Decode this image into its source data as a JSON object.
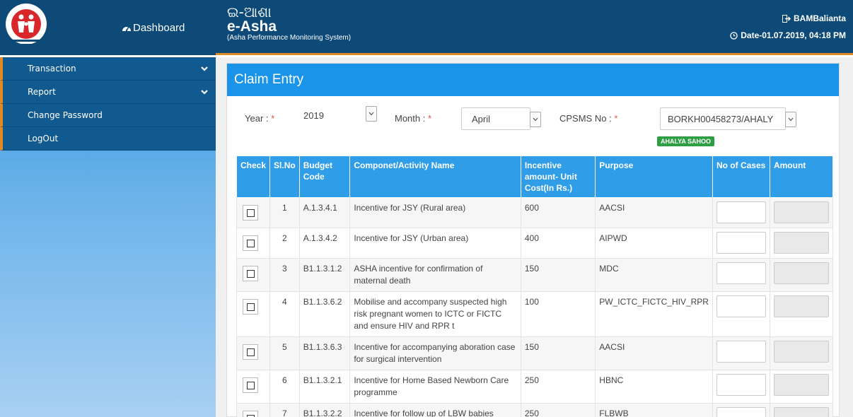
{
  "header": {
    "dashboard_label": "Dashboard",
    "brand_odia": "ଇ-ଆଶା",
    "brand_name": "e-Asha",
    "brand_subtitle": "(Asha Performance Monitoring System)",
    "user": "BAMBalianta",
    "date": "Date-01.07.2019, 04:18 PM",
    "logo_text": "NATIONAL RURAL HEALTH MISSION"
  },
  "sidebar": {
    "items": [
      {
        "label": "Transaction",
        "has_submenu": true
      },
      {
        "label": "Report",
        "has_submenu": true
      },
      {
        "label": "Change Password",
        "has_submenu": false
      },
      {
        "label": "LogOut",
        "has_submenu": false
      }
    ]
  },
  "panel": {
    "title": "Claim Entry"
  },
  "filters": {
    "year_label": "Year :",
    "year_value": "2019",
    "month_label": "Month :",
    "month_value": "April",
    "cpsms_label": "CPSMS No :",
    "cpsms_value": "BORKH00458273/AHALY",
    "required_mark": "*",
    "asha_name": "AHALYA SAHOO"
  },
  "table": {
    "headers": [
      "Check",
      "Sl.No",
      "Budget Code",
      "Componet/Activity Name",
      "Incentive amount- Unit Cost(In Rs.)",
      "Purpose",
      "No of Cases",
      "Amount"
    ],
    "rows": [
      {
        "sl": "1",
        "code": "A.1.3.4.1",
        "activity": "Incentive for JSY (Rural area)",
        "cost": "600",
        "purpose": "AACSI"
      },
      {
        "sl": "2",
        "code": "A.1.3.4.2",
        "activity": "Incentive for JSY (Urban area)",
        "cost": "400",
        "purpose": "AIPWD"
      },
      {
        "sl": "3",
        "code": "B1.1.3.1.2",
        "activity": "ASHA incentive for confirmation of maternal death",
        "cost": "150",
        "purpose": "MDC"
      },
      {
        "sl": "4",
        "code": "B1.1.3.6.2",
        "activity": "Mobilise and accompany suspected high risk pregnant women to ICTC or FICTC and ensure HIV and RPR t",
        "cost": "100",
        "purpose": "PW_ICTC_FICTC_HIV_RPR"
      },
      {
        "sl": "5",
        "code": "B1.1.3.6.3",
        "activity": "Incentive for accompanying aboration case for surgical intervention",
        "cost": "150",
        "purpose": "AACSI"
      },
      {
        "sl": "6",
        "code": "B1.1.3.2.1",
        "activity": "Incentive for Home Based Newborn Care programme",
        "cost": "250",
        "purpose": "HBNC"
      },
      {
        "sl": "7",
        "code": "B1.1.3.2.2",
        "activity": "Incentive for follow up of LBW babies",
        "cost": "250",
        "purpose": "FLBWB"
      }
    ]
  }
}
